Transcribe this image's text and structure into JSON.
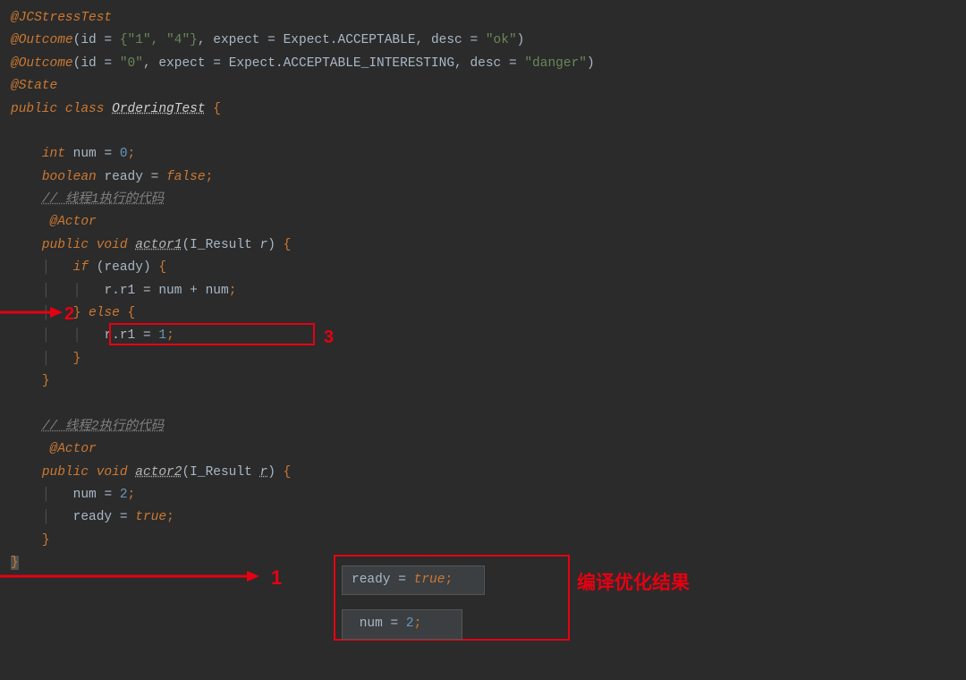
{
  "annotations": {
    "jcstresstest": "@JCStressTest",
    "outcome1_prefix": "@Outcome",
    "outcome1_id_label": "id",
    "outcome1_id_val": "{\"1\", \"4\"}",
    "outcome1_expect_label": "expect",
    "outcome1_expect_val": "Expect.ACCEPTABLE",
    "outcome1_desc_label": "desc",
    "outcome1_desc_val": "\"ok\"",
    "outcome2_id_val": "\"0\"",
    "outcome2_expect_val": "Expect.ACCEPTABLE_INTERESTING",
    "outcome2_desc_val": "\"danger\"",
    "state": "@State",
    "actor_anno": "@Actor"
  },
  "class_decl": {
    "public": "public",
    "class_kw": "class",
    "name": "OrderingTest",
    "open": "{",
    "close": "}"
  },
  "fields": {
    "int_kw": "int",
    "num_name": "num",
    "zero": "0",
    "bool_kw": "boolean",
    "ready_name": "ready",
    "false_kw": "false",
    "true_kw": "true",
    "two": "2"
  },
  "comments": {
    "thread1": "// 线程1执行的代码",
    "thread2": "// 线程2执行的代码"
  },
  "methods": {
    "void_kw": "void",
    "actor1": "actor1",
    "actor2": "actor2",
    "param_type": "I_Result",
    "param_name": "r",
    "if_kw": "if",
    "else_kw": "else",
    "r_r1": "r.r1",
    "one": "1",
    "eq": "=",
    "plus": "+"
  },
  "labels": {
    "n1": "1",
    "n2": "2",
    "n3": "3",
    "opt_result": "编译优化结果"
  },
  "opt_code": {
    "line1_ready": "ready",
    "line1_true": "true",
    "line2_num": "num",
    "line2_2": "2"
  }
}
